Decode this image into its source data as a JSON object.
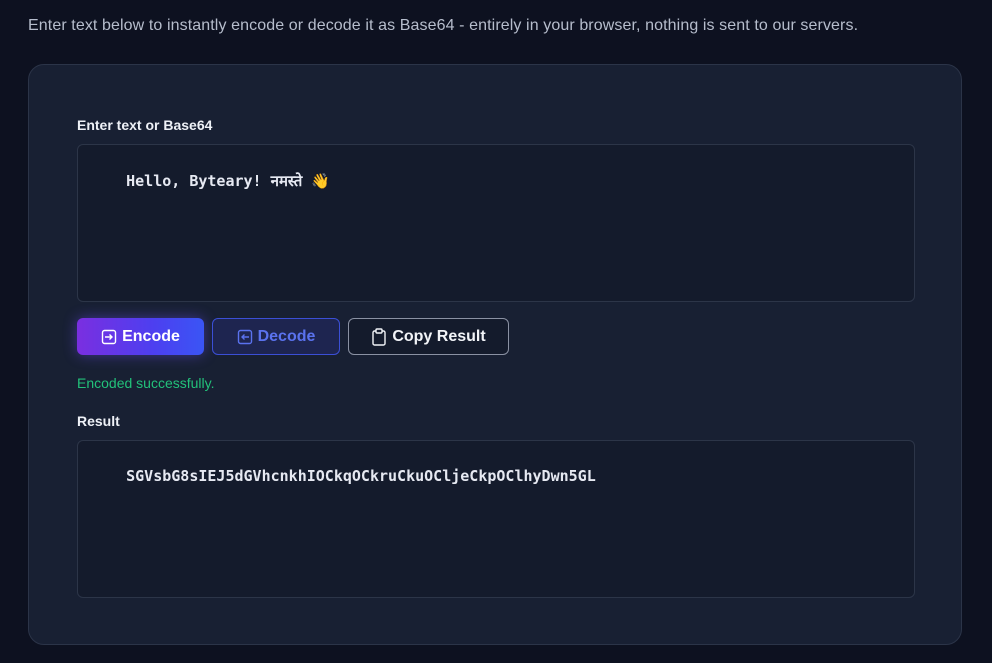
{
  "intro_text": "Enter text below to instantly encode or decode it as Base64 - entirely in your browser, nothing is sent to our servers.",
  "input": {
    "label": "Enter text or Base64",
    "value": "Hello, Byteary! नमस्ते 👋"
  },
  "buttons": {
    "encode_label": "Encode",
    "decode_label": "Decode",
    "copy_label": "Copy Result"
  },
  "status_message": "Encoded successfully.",
  "result": {
    "label": "Result",
    "value": "SGVsbG8sIEJ5dGVhcnkhIOCkqOCkruCkuOCljeCkpOClhyDwn5GL"
  },
  "colors": {
    "background": "#0d1120",
    "panel": "#182033",
    "encode_gradient_start": "#7a2fe0",
    "encode_gradient_end": "#3a55f5",
    "decode_accent": "#5a72ee",
    "success": "#22c17a"
  }
}
